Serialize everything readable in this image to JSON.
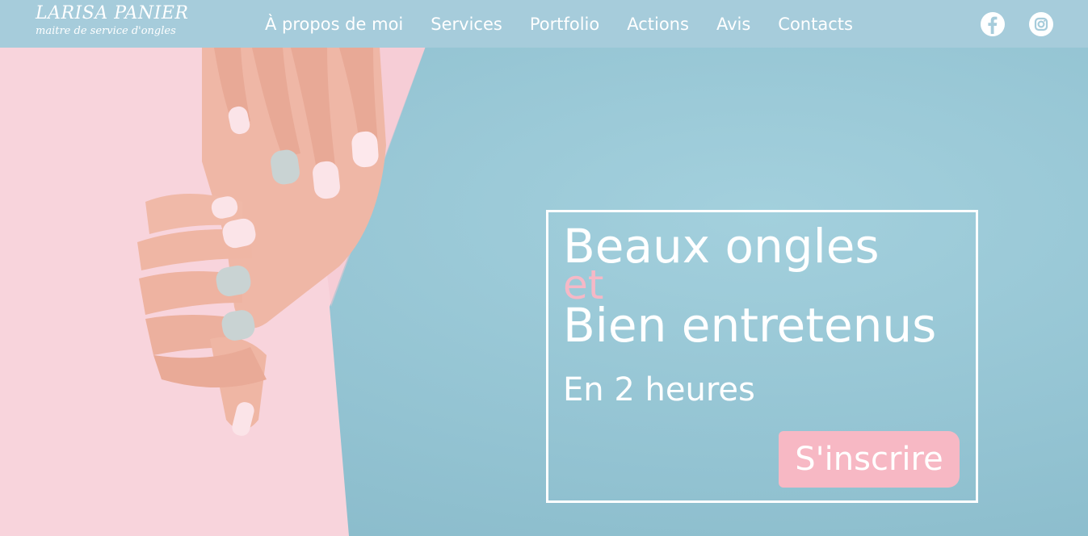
{
  "brand": {
    "name": "LARISA PANIER",
    "tagline": "maitre de service d'ongles"
  },
  "nav": {
    "items": [
      {
        "label": "À propos de moi"
      },
      {
        "label": "Services"
      },
      {
        "label": "Portfolio"
      },
      {
        "label": "Actions"
      },
      {
        "label": "Avis"
      },
      {
        "label": "Contacts"
      }
    ]
  },
  "social": {
    "icons": [
      "facebook-icon",
      "instagram-icon"
    ]
  },
  "hero": {
    "line1": "Beaux ongles",
    "connector": "et",
    "line2": "Bien entretenus",
    "subtitle": "En 2 heures",
    "cta_label": "S'inscrire"
  },
  "colors": {
    "header_bg": "#a6ccdb",
    "hero_bg": "#93c4d3",
    "pink_panel": "#f8d3dc",
    "accent_pink": "#f7b8c4",
    "text": "#ffffff"
  }
}
